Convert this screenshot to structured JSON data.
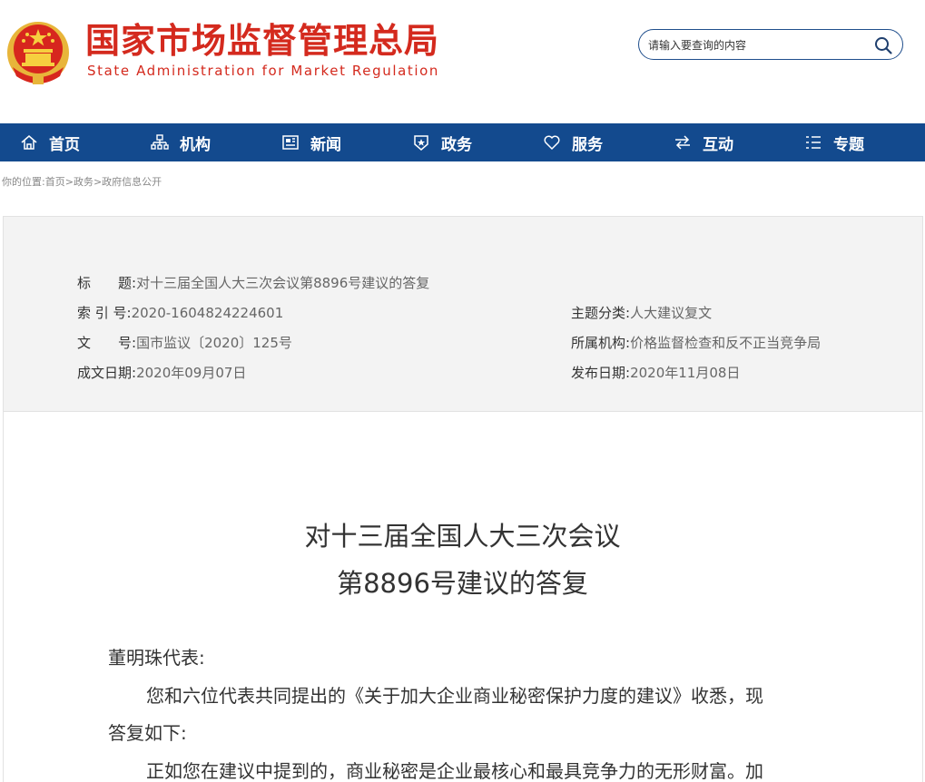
{
  "header": {
    "site_name_cn": "国家市场监督管理总局",
    "site_name_en": "State Administration for Market Regulation",
    "search_placeholder": "请输入要查询的内容"
  },
  "nav": {
    "items": [
      {
        "label": "首页",
        "icon": "home-icon"
      },
      {
        "label": "机构",
        "icon": "org-chart-icon"
      },
      {
        "label": "新闻",
        "icon": "newspaper-icon"
      },
      {
        "label": "政务",
        "icon": "badge-icon"
      },
      {
        "label": "服务",
        "icon": "heart-icon"
      },
      {
        "label": "互动",
        "icon": "exchange-icon"
      },
      {
        "label": "专题",
        "icon": "list-icon"
      }
    ]
  },
  "breadcrumb": {
    "prefix": "你的位置:",
    "items": [
      "首页",
      "政务",
      "政府信息公开"
    ],
    "separator": ">"
  },
  "meta": {
    "title_label": "标　　题:",
    "title_value": "对十三届全国人大三次会议第8896号建议的答复",
    "index_label": "索 引 号:",
    "index_value": "2020-1604824224601",
    "topic_label": "主题分类:",
    "topic_value": "人大建议复文",
    "doc_label": "文　　号:",
    "doc_value": "国市监议〔2020〕125号",
    "org_label": "所属机构:",
    "org_value": "价格监督检查和反不正当竞争局",
    "created_label": "成文日期:",
    "created_value": "2020年09月07日",
    "published_label": "发布日期:",
    "published_value": "2020年11月08日"
  },
  "article": {
    "title_line1": "对十三届全国人大三次会议",
    "title_line2": "第8896号建议的答复",
    "salutation": "董明珠代表:",
    "para1_line1": "您和六位代表共同提出的《关于加大企业商业秘密保护力度的建议》收悉，现",
    "para1_line2": "答复如下:",
    "para2_line1": "正如您在建议中提到的，商业秘密是企业最核心和最具竞争力的无形财富。加"
  },
  "colors": {
    "brand_red": "#d42a1e",
    "nav_blue": "#134a8e"
  }
}
